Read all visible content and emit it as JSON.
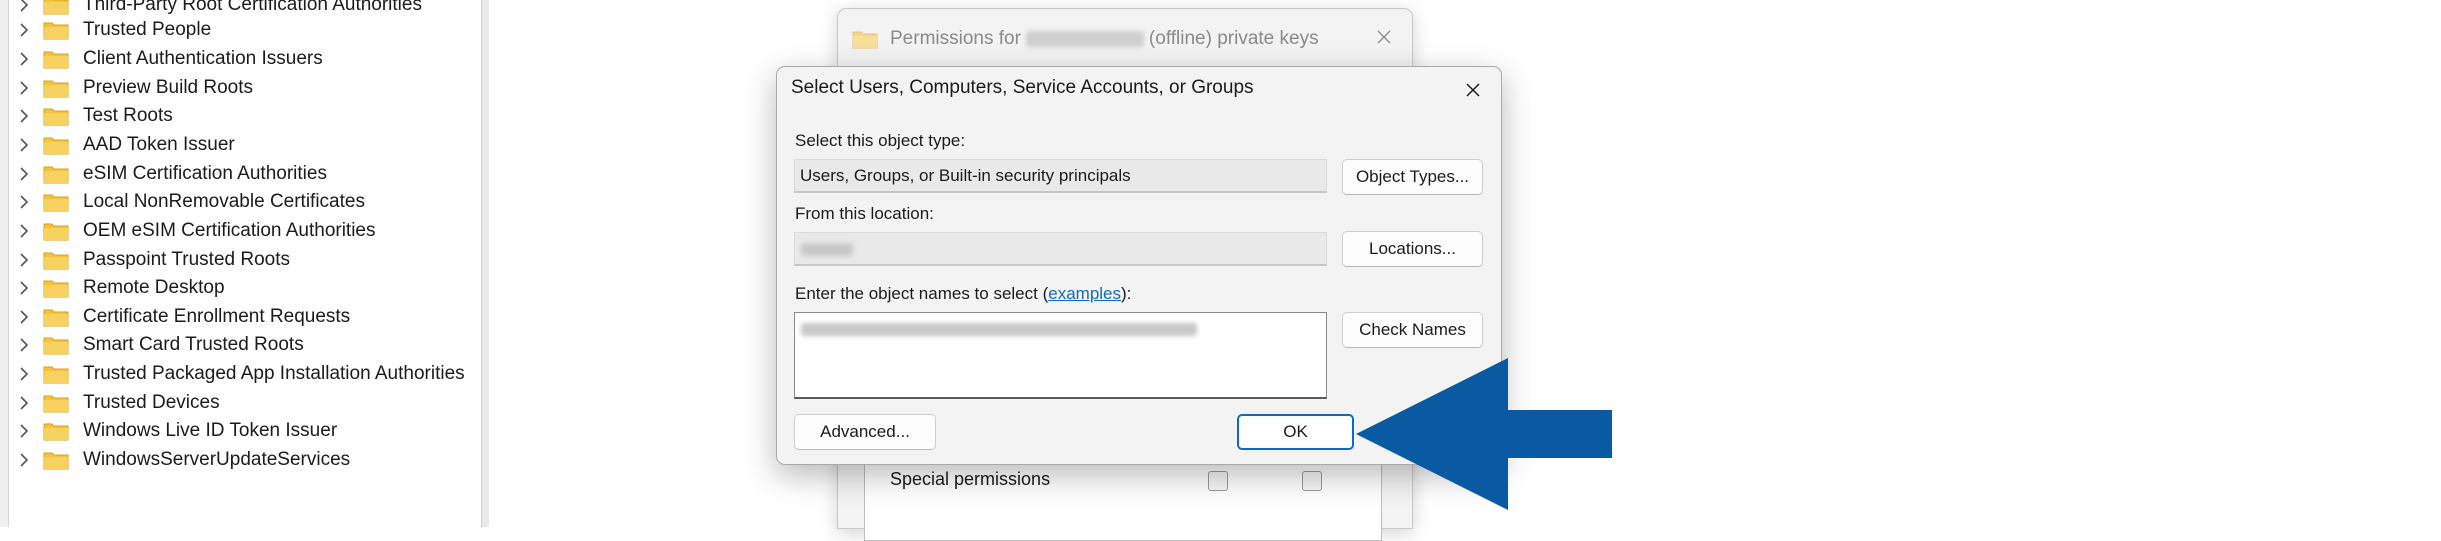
{
  "tree": {
    "items": [
      {
        "label": "Third-Party Root Certification Authorities"
      },
      {
        "label": "Trusted People"
      },
      {
        "label": "Client Authentication Issuers"
      },
      {
        "label": "Preview Build Roots"
      },
      {
        "label": "Test Roots"
      },
      {
        "label": "AAD Token Issuer"
      },
      {
        "label": "eSIM Certification Authorities"
      },
      {
        "label": "Local NonRemovable Certificates"
      },
      {
        "label": "OEM eSIM Certification Authorities"
      },
      {
        "label": "Passpoint Trusted Roots"
      },
      {
        "label": "Remote Desktop"
      },
      {
        "label": "Certificate Enrollment Requests"
      },
      {
        "label": "Smart Card Trusted Roots"
      },
      {
        "label": "Trusted Packaged App Installation Authorities"
      },
      {
        "label": "Trusted Devices"
      },
      {
        "label": "Windows Live ID Token Issuer"
      },
      {
        "label": "WindowsServerUpdateServices"
      }
    ]
  },
  "permissions_dialog": {
    "title_prefix": "Permissions for",
    "title_suffix": "(offline) private keys",
    "row_label": "Special permissions"
  },
  "select_dialog": {
    "title": "Select Users, Computers, Service Accounts, or Groups",
    "object_type_label": "Select this object type:",
    "object_type_value": "Users, Groups, or Built-in security principals",
    "object_types_button": "Object Types...",
    "location_label": "From this location:",
    "locations_button": "Locations...",
    "names_label_prefix": "Enter the object names to select (",
    "names_label_link": "examples",
    "names_label_suffix": "):",
    "check_names_button": "Check Names",
    "advanced_button": "Advanced...",
    "ok_button": "OK"
  },
  "colors": {
    "accent": "#0f6cbd",
    "arrow": "#0a5aa3",
    "folder": "#f5c43c"
  }
}
